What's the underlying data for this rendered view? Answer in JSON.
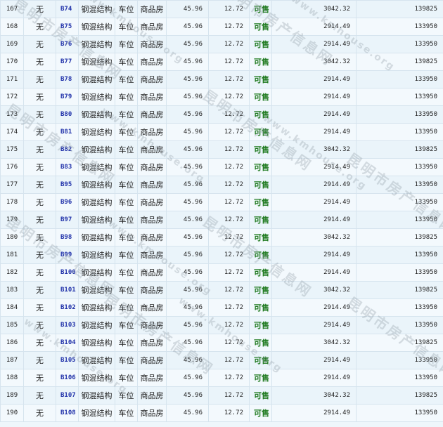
{
  "rows": [
    {
      "no": "167",
      "mark": "无",
      "room": "B74",
      "struct": "钢混结构",
      "use": "车位",
      "type": "商品房",
      "area": "45.96",
      "area2": "12.72",
      "status": "可售",
      "price": "3042.32",
      "total": "139825"
    },
    {
      "no": "168",
      "mark": "无",
      "room": "B75",
      "struct": "钢混结构",
      "use": "车位",
      "type": "商品房",
      "area": "45.96",
      "area2": "12.72",
      "status": "可售",
      "price": "2914.49",
      "total": "133950"
    },
    {
      "no": "169",
      "mark": "无",
      "room": "B76",
      "struct": "钢混结构",
      "use": "车位",
      "type": "商品房",
      "area": "45.96",
      "area2": "12.72",
      "status": "可售",
      "price": "2914.49",
      "total": "133950"
    },
    {
      "no": "170",
      "mark": "无",
      "room": "B77",
      "struct": "钢混结构",
      "use": "车位",
      "type": "商品房",
      "area": "45.96",
      "area2": "12.72",
      "status": "可售",
      "price": "3042.32",
      "total": "139825"
    },
    {
      "no": "171",
      "mark": "无",
      "room": "B78",
      "struct": "钢混结构",
      "use": "车位",
      "type": "商品房",
      "area": "45.96",
      "area2": "12.72",
      "status": "可售",
      "price": "2914.49",
      "total": "133950"
    },
    {
      "no": "172",
      "mark": "无",
      "room": "B79",
      "struct": "钢混结构",
      "use": "车位",
      "type": "商品房",
      "area": "45.96",
      "area2": "12.72",
      "status": "可售",
      "price": "2914.49",
      "total": "133950"
    },
    {
      "no": "173",
      "mark": "无",
      "room": "B80",
      "struct": "钢混结构",
      "use": "车位",
      "type": "商品房",
      "area": "45.96",
      "area2": "12.72",
      "status": "可售",
      "price": "2914.49",
      "total": "133950"
    },
    {
      "no": "174",
      "mark": "无",
      "room": "B81",
      "struct": "钢混结构",
      "use": "车位",
      "type": "商品房",
      "area": "45.96",
      "area2": "12.72",
      "status": "可售",
      "price": "2914.49",
      "total": "133950"
    },
    {
      "no": "175",
      "mark": "无",
      "room": "B82",
      "struct": "钢混结构",
      "use": "车位",
      "type": "商品房",
      "area": "45.96",
      "area2": "12.72",
      "status": "可售",
      "price": "3042.32",
      "total": "139825"
    },
    {
      "no": "176",
      "mark": "无",
      "room": "B83",
      "struct": "钢混结构",
      "use": "车位",
      "type": "商品房",
      "area": "45.96",
      "area2": "12.72",
      "status": "可售",
      "price": "2914.49",
      "total": "133950"
    },
    {
      "no": "177",
      "mark": "无",
      "room": "B95",
      "struct": "钢混结构",
      "use": "车位",
      "type": "商品房",
      "area": "45.96",
      "area2": "12.72",
      "status": "可售",
      "price": "2914.49",
      "total": "133950"
    },
    {
      "no": "178",
      "mark": "无",
      "room": "B96",
      "struct": "钢混结构",
      "use": "车位",
      "type": "商品房",
      "area": "45.96",
      "area2": "12.72",
      "status": "可售",
      "price": "2914.49",
      "total": "133950"
    },
    {
      "no": "179",
      "mark": "无",
      "room": "B97",
      "struct": "钢混结构",
      "use": "车位",
      "type": "商品房",
      "area": "45.96",
      "area2": "12.72",
      "status": "可售",
      "price": "2914.49",
      "total": "133950"
    },
    {
      "no": "180",
      "mark": "无",
      "room": "B98",
      "struct": "钢混结构",
      "use": "车位",
      "type": "商品房",
      "area": "45.96",
      "area2": "12.72",
      "status": "可售",
      "price": "3042.32",
      "total": "139825"
    },
    {
      "no": "181",
      "mark": "无",
      "room": "B99",
      "struct": "钢混结构",
      "use": "车位",
      "type": "商品房",
      "area": "45.96",
      "area2": "12.72",
      "status": "可售",
      "price": "2914.49",
      "total": "133950"
    },
    {
      "no": "182",
      "mark": "无",
      "room": "B100",
      "struct": "钢混结构",
      "use": "车位",
      "type": "商品房",
      "area": "45.96",
      "area2": "12.72",
      "status": "可售",
      "price": "2914.49",
      "total": "133950"
    },
    {
      "no": "183",
      "mark": "无",
      "room": "B101",
      "struct": "钢混结构",
      "use": "车位",
      "type": "商品房",
      "area": "45.96",
      "area2": "12.72",
      "status": "可售",
      "price": "3042.32",
      "total": "139825"
    },
    {
      "no": "184",
      "mark": "无",
      "room": "B102",
      "struct": "钢混结构",
      "use": "车位",
      "type": "商品房",
      "area": "45.96",
      "area2": "12.72",
      "status": "可售",
      "price": "2914.49",
      "total": "133950"
    },
    {
      "no": "185",
      "mark": "无",
      "room": "B103",
      "struct": "钢混结构",
      "use": "车位",
      "type": "商品房",
      "area": "45.96",
      "area2": "12.72",
      "status": "可售",
      "price": "2914.49",
      "total": "133950"
    },
    {
      "no": "186",
      "mark": "无",
      "room": "B104",
      "struct": "钢混结构",
      "use": "车位",
      "type": "商品房",
      "area": "45.96",
      "area2": "12.72",
      "status": "可售",
      "price": "3042.32",
      "total": "139825"
    },
    {
      "no": "187",
      "mark": "无",
      "room": "B105",
      "struct": "钢混结构",
      "use": "车位",
      "type": "商品房",
      "area": "45.96",
      "area2": "12.72",
      "status": "可售",
      "price": "2914.49",
      "total": "133950"
    },
    {
      "no": "188",
      "mark": "无",
      "room": "B106",
      "struct": "钢混结构",
      "use": "车位",
      "type": "商品房",
      "area": "45.96",
      "area2": "12.72",
      "status": "可售",
      "price": "2914.49",
      "total": "133950"
    },
    {
      "no": "189",
      "mark": "无",
      "room": "B107",
      "struct": "钢混结构",
      "use": "车位",
      "type": "商品房",
      "area": "45.96",
      "area2": "12.72",
      "status": "可售",
      "price": "3042.32",
      "total": "139825"
    },
    {
      "no": "190",
      "mark": "无",
      "room": "B108",
      "struct": "钢混结构",
      "use": "车位",
      "type": "商品房",
      "area": "45.96",
      "area2": "12.72",
      "status": "可售",
      "price": "2914.49",
      "total": "133950"
    }
  ],
  "watermark": {
    "cn": "昆明市房产信息网",
    "url": "www.kmhouse.org"
  },
  "colors": {
    "room_link": "#2233aa",
    "status_available": "#1f7a1f",
    "row_bg": "#eaf4fa"
  }
}
